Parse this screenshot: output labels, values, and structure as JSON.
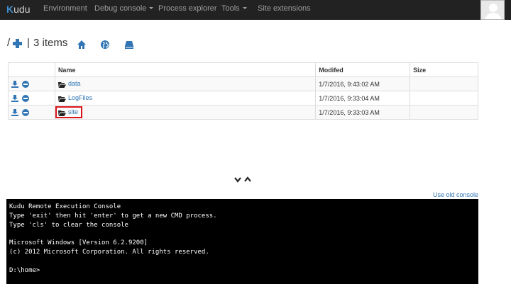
{
  "navbar": {
    "brand_k": "K",
    "brand_rest": "udu",
    "items": [
      {
        "label": "Environment"
      },
      {
        "label": "Debug console",
        "dropdown": true
      },
      {
        "label": "Process explorer"
      },
      {
        "label": "Tools",
        "dropdown": true
      },
      {
        "label": "Site extensions"
      }
    ]
  },
  "path": {
    "root": "/",
    "separator": "|",
    "count_text": "3 items"
  },
  "table": {
    "headers": [
      "",
      "Name",
      "Modifed",
      "Size"
    ],
    "rows": [
      {
        "name": "data",
        "modified": "1/7/2016, 9:43:02 AM",
        "size": ""
      },
      {
        "name": "LogFiles",
        "modified": "1/7/2016, 9:33:04 AM",
        "size": ""
      },
      {
        "name": "site",
        "modified": "1/7/2016, 9:33:03 AM",
        "size": "",
        "highlighted": true
      }
    ]
  },
  "console": {
    "old_console_link": "Use old console",
    "lines": [
      "Kudu Remote Execution Console",
      "Type 'exit' then hit 'enter' to get a new CMD process.",
      "Type 'cls' to clear the console",
      "",
      "Microsoft Windows [Version 6.2.9200]",
      "(c) 2012 Microsoft Corporation. All rights reserved.",
      "",
      "D:\\home>"
    ]
  },
  "colors": {
    "navbar_bg": "#222222",
    "accent": "#3275b4",
    "highlight_border": "#d9151b",
    "console_bg": "#000000"
  },
  "icons": [
    "plus-icon",
    "home-icon",
    "globe-icon",
    "drive-icon",
    "download-icon",
    "remove-icon",
    "folder-open-icon",
    "chevron-down-icon",
    "chevron-up-icon",
    "user-avatar"
  ]
}
